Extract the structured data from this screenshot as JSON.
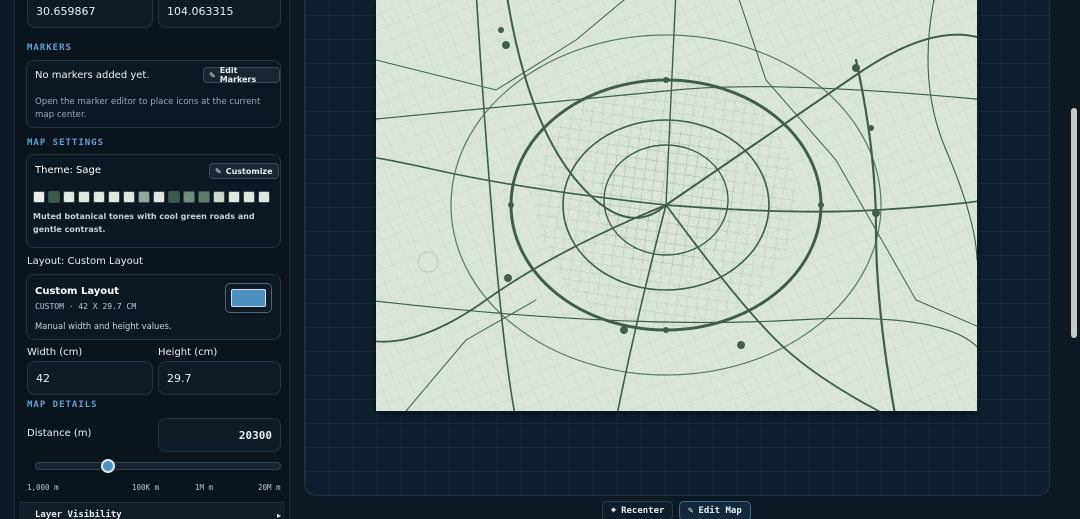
{
  "coordinates": {
    "latitude": "30.659867",
    "longitude": "104.063315"
  },
  "markers": {
    "section_title": "MARKERS",
    "empty_text": "No markers added yet.",
    "edit_button": "Edit Markers",
    "help_text": "Open the marker editor to place icons at the current map center."
  },
  "map_settings": {
    "section_title": "MAP SETTINGS",
    "theme_label": "Theme: Sage",
    "customize_button": "Customize",
    "swatches": [
      "#e8efe6",
      "#3a5a4a",
      "#dfe8dc",
      "#dfe8dc",
      "#dfe8dc",
      "#dfe8dc",
      "#dfe8dc",
      "#8fa99a",
      "#e0e8dd",
      "#3a5a4a",
      "#6f8d7c",
      "#5d7c6b",
      "#c9d8c7",
      "#dfe8dc",
      "#dfe8dc",
      "#dfe8dc"
    ],
    "theme_description": "Muted botanical tones with cool green roads and gentle contrast.",
    "layout_label": "Layout: Custom Layout",
    "layout_card_title": "Custom Layout",
    "layout_card_subtitle": "CUSTOM · 42 X 29.7 CM",
    "layout_card_description": "Manual width and height values.",
    "width_label": "Width (cm)",
    "height_label": "Height (cm)",
    "width_value": "42",
    "height_value": "29.7"
  },
  "map_details": {
    "section_title": "MAP DETAILS",
    "distance_label": "Distance (m)",
    "distance_value": "20300",
    "slider_fraction": 0.28,
    "slider_ticks": [
      "1,000 m",
      "100K m",
      "1M m",
      "20M m"
    ]
  },
  "layer_visibility": {
    "label": "Layer Visibility"
  },
  "footer": {
    "recenter_button": "Recenter",
    "edit_map_button": "Edit Map"
  },
  "colors": {
    "accent": "#5aa3d4",
    "map_background": "#d9e5d8",
    "road_color": "#3f5e4d",
    "panel_background": "#0a141d"
  },
  "icons": {
    "edit": "pencil-square-icon",
    "recenter": "crosshair-icon",
    "expand": "chevron-right-icon"
  }
}
